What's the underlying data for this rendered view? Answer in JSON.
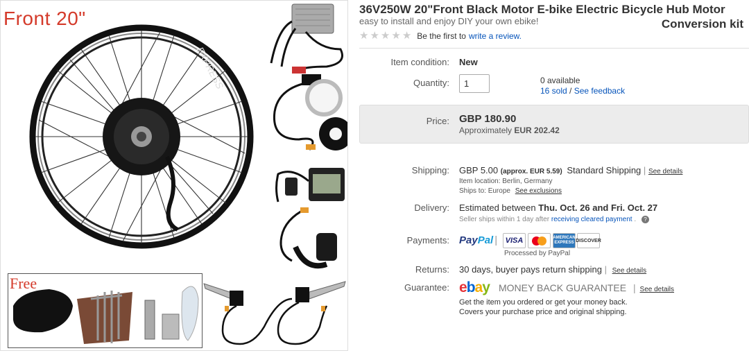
{
  "product": {
    "title_line1": "36V250W 20\"Front Black Motor E-bike Electric Bicycle Hub Motor",
    "title_line2": "Conversion kit",
    "subtitle": "easy to install and enjoy DIY your own ebike!",
    "rating_stars": 0,
    "review_prompt": "Be the first to",
    "review_link": "write a review."
  },
  "images": {
    "front_label": "Front 20\"",
    "free_label": "Free",
    "rim_brand": "EXPRESS"
  },
  "condition": {
    "label": "Item condition:",
    "value": "New"
  },
  "quantity": {
    "label": "Quantity:",
    "value": "1",
    "available": "0 available",
    "sold": "16 sold",
    "separator": " / ",
    "feedback": "See feedback"
  },
  "price": {
    "label": "Price:",
    "value": "GBP 180.90",
    "approx_prefix": "Approximately",
    "approx_value": "EUR 202.42"
  },
  "shipping": {
    "label": "Shipping:",
    "value": "GBP 5.00",
    "approx": "(approx. EUR 5.59)",
    "method": "Standard Shipping",
    "details_link": "See details",
    "location": "Item location:  Berlin, Germany",
    "ships_to_prefix": "Ships to:  Europe",
    "exclusions_link": "See exclusions"
  },
  "delivery": {
    "label": "Delivery:",
    "prefix": "Estimated between",
    "range": "Thu. Oct. 26 and Fri. Oct. 27",
    "note_prefix": "Seller ships within 1 day after",
    "note_link": "receiving cleared payment",
    "note_suffix": "."
  },
  "payments": {
    "label": "Payments:",
    "paypal_a": "Pay",
    "paypal_b": "Pal",
    "processed": "Processed by PayPal",
    "cards": [
      "VISA",
      "MasterCard",
      "AMERICAN EXPRESS",
      "DISCOVER"
    ]
  },
  "returns": {
    "label": "Returns:",
    "value": "30 days, buyer pays return shipping",
    "details_link": "See details"
  },
  "guarantee": {
    "label": "Guarantee:",
    "logo_e": "e",
    "logo_b": "b",
    "logo_a": "a",
    "logo_y": "y",
    "text": "MONEY BACK GUARANTEE",
    "details_link": "See details",
    "line1": "Get the item you ordered or get your money back.",
    "line2": "Covers your purchase price and original shipping."
  },
  "colors": {
    "link": "#0654ba",
    "accent_red": "#d43a2a",
    "ebay_red": "#e53238",
    "ebay_blue": "#0064d2",
    "ebay_yellow": "#f5af02",
    "ebay_green": "#86b817"
  }
}
